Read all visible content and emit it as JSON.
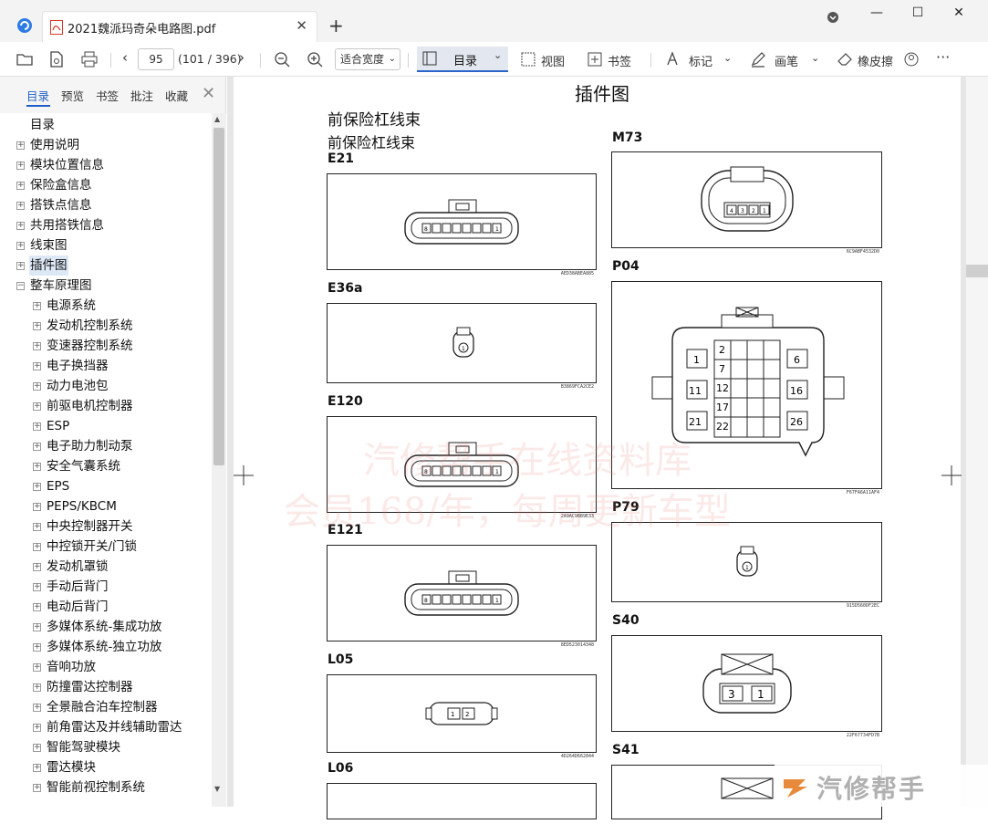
{
  "titlebar": {
    "tab_title": "2021魏派玛奇朵电路图.pdf",
    "tab_close": "✕",
    "new_tab": "+",
    "minimize": "—",
    "maximize": "☐",
    "close": "✕"
  },
  "toolbar": {
    "page_current": "95",
    "page_info": "(101 / 396)",
    "zoom_value": "适合宽度",
    "toc_label": "目录",
    "view_label": "视图",
    "bookmark_label": "书签",
    "mark_label": "标记",
    "pen_label": "画笔",
    "eraser_label": "橡皮擦",
    "more": "···"
  },
  "sidebar": {
    "tabs": [
      "目录",
      "预览",
      "书签",
      "批注",
      "收藏"
    ],
    "close": "✕",
    "tree": [
      {
        "label": "目录",
        "level": 0,
        "expander": false
      },
      {
        "label": "使用说明",
        "level": 0,
        "expander": true
      },
      {
        "label": "模块位置信息",
        "level": 0,
        "expander": true
      },
      {
        "label": "保险盒信息",
        "level": 0,
        "expander": true
      },
      {
        "label": "搭铁点信息",
        "level": 0,
        "expander": true
      },
      {
        "label": "共用搭铁信息",
        "level": 0,
        "expander": true
      },
      {
        "label": "线束图",
        "level": 0,
        "expander": true
      },
      {
        "label": "插件图",
        "level": 0,
        "expander": true,
        "selected": true
      },
      {
        "label": "整车原理图",
        "level": 0,
        "expander": true,
        "expanded": true
      },
      {
        "label": "电源系统",
        "level": 1,
        "expander": true
      },
      {
        "label": "发动机控制系统",
        "level": 1,
        "expander": true
      },
      {
        "label": "变速器控制系统",
        "level": 1,
        "expander": true
      },
      {
        "label": "电子换挡器",
        "level": 1,
        "expander": true
      },
      {
        "label": "动力电池包",
        "level": 1,
        "expander": true
      },
      {
        "label": "前驱电机控制器",
        "level": 1,
        "expander": true
      },
      {
        "label": "ESP",
        "level": 1,
        "expander": true
      },
      {
        "label": "电子助力制动泵",
        "level": 1,
        "expander": true
      },
      {
        "label": "安全气囊系统",
        "level": 1,
        "expander": true
      },
      {
        "label": "EPS",
        "level": 1,
        "expander": true
      },
      {
        "label": "PEPS/KBCM",
        "level": 1,
        "expander": true
      },
      {
        "label": "中央控制器开关",
        "level": 1,
        "expander": true
      },
      {
        "label": "中控锁开关/门锁",
        "level": 1,
        "expander": true
      },
      {
        "label": "发动机罩锁",
        "level": 1,
        "expander": true
      },
      {
        "label": "手动后背门",
        "level": 1,
        "expander": true
      },
      {
        "label": "电动后背门",
        "level": 1,
        "expander": true
      },
      {
        "label": "多媒体系统-集成功放",
        "level": 1,
        "expander": true
      },
      {
        "label": "多媒体系统-独立功放",
        "level": 1,
        "expander": true
      },
      {
        "label": "音响功放",
        "level": 1,
        "expander": true
      },
      {
        "label": "防撞雷达控制器",
        "level": 1,
        "expander": true
      },
      {
        "label": "全景融合泊车控制器",
        "level": 1,
        "expander": true
      },
      {
        "label": "前角雷达及并线辅助雷达",
        "level": 1,
        "expander": true
      },
      {
        "label": "智能驾驶模块",
        "level": 1,
        "expander": true
      },
      {
        "label": "雷达模块",
        "level": 1,
        "expander": true
      },
      {
        "label": "智能前视控制系统",
        "level": 1,
        "expander": true
      }
    ]
  },
  "document": {
    "page_title": "插件图",
    "section_title": "前保险杠线束",
    "section_subtitle": "前保险杠线束",
    "connectors_left": [
      {
        "label": "E21",
        "code": "AED38ABEA885",
        "pins": [
          "8",
          "1"
        ]
      },
      {
        "label": "E36a",
        "code": "B3869FCA2CE2",
        "pins": [
          "1"
        ]
      },
      {
        "label": "E120",
        "code": "2A9AC9BB9E33",
        "pins": [
          "8",
          "1"
        ]
      },
      {
        "label": "E121",
        "code": "8ED523014348",
        "pins": [
          "8",
          "1"
        ]
      },
      {
        "label": "L05",
        "code": "4D264D662844",
        "pins": [
          "1",
          "2"
        ]
      },
      {
        "label": "L06",
        "code": "",
        "pins": []
      }
    ],
    "connectors_right": [
      {
        "label": "M73",
        "code": "6C9ABF4532D0",
        "pins": [
          "4",
          "3",
          "2",
          "1"
        ]
      },
      {
        "label": "P04",
        "code": "F67FA6A11AF4",
        "pins": [
          "1",
          "2",
          "6",
          "7",
          "11",
          "12",
          "16",
          "17",
          "21",
          "22",
          "26"
        ]
      },
      {
        "label": "P79",
        "code": "915D560DF2EC",
        "pins": [
          "1"
        ]
      },
      {
        "label": "S40",
        "code": "22F67734FD7B",
        "pins": [
          "3",
          "1"
        ]
      },
      {
        "label": "S41",
        "code": "",
        "pins": []
      }
    ],
    "watermark_line1": "汽修帮手在线资料库",
    "watermark_line2": "会员168/年，每周更新车型",
    "brand": "汽修帮手"
  }
}
